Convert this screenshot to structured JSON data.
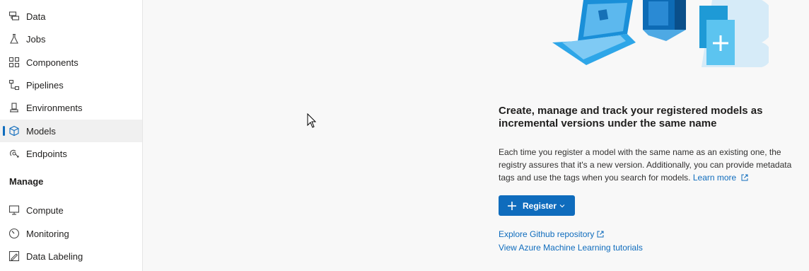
{
  "sidebar": {
    "items": [
      {
        "label": "Data",
        "icon": "data-icon"
      },
      {
        "label": "Jobs",
        "icon": "flask-icon"
      },
      {
        "label": "Components",
        "icon": "components-icon"
      },
      {
        "label": "Pipelines",
        "icon": "pipelines-icon"
      },
      {
        "label": "Environments",
        "icon": "environments-icon"
      },
      {
        "label": "Models",
        "icon": "cube-icon",
        "active": true
      },
      {
        "label": "Endpoints",
        "icon": "endpoints-icon"
      }
    ],
    "manage_heading": "Manage",
    "manage_items": [
      {
        "label": "Compute",
        "icon": "monitor-icon"
      },
      {
        "label": "Monitoring",
        "icon": "gauge-icon"
      },
      {
        "label": "Data Labeling",
        "icon": "labeling-icon"
      }
    ]
  },
  "main": {
    "headline": "Create, manage and track your registered models as incremental versions under the same name",
    "description": "Each time you register a model with the same name as an existing one, the registry assures that it's a new version. Additionally, you can provide metadata tags and use the tags when you search for models.",
    "learn_more": "Learn more",
    "register_button": "Register",
    "github_link": "Explore Github repository",
    "tutorials_link": "View Azure Machine Learning tutorials"
  },
  "colors": {
    "accent": "#0f6cbd",
    "sidebar_bg": "#ffffff",
    "page_bg": "#f8f8f8"
  }
}
